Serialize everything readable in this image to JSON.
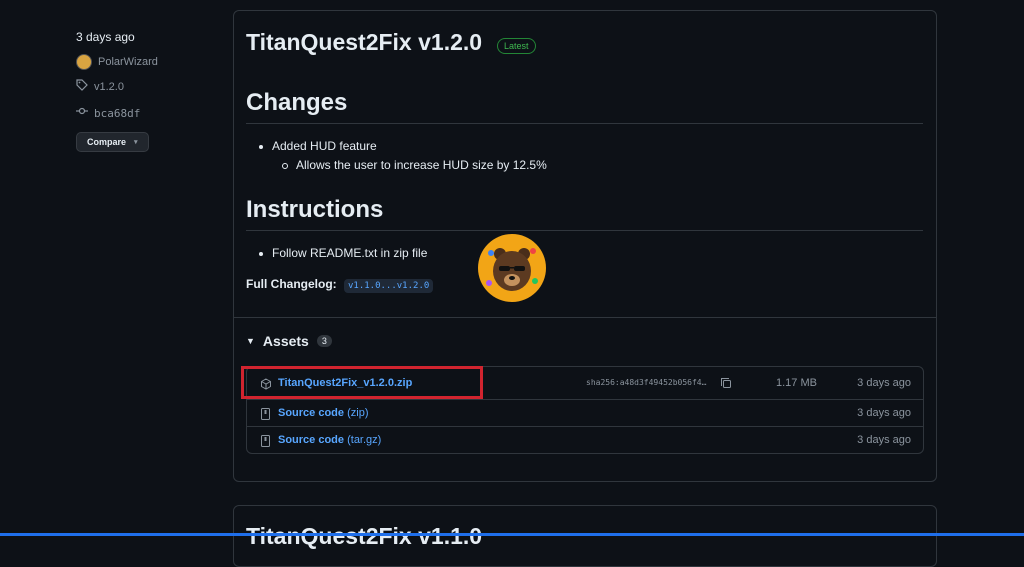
{
  "sidebar": {
    "date": "3 days ago",
    "author": "PolarWizard",
    "tag": "v1.2.0",
    "commit": "bca68df",
    "compare_label": "Compare"
  },
  "release": {
    "title": "TitanQuest2Fix v1.2.0",
    "badge": "Latest",
    "changes_heading": "Changes",
    "changes_item": "Added HUD feature",
    "changes_subitem": "Allows the user to increase HUD size by 12.5%",
    "instructions_heading": "Instructions",
    "instructions_item": "Follow README.txt in zip file",
    "changelog_label": "Full Changelog:",
    "changelog_link": "v1.1.0...v1.2.0"
  },
  "assets": {
    "heading": "Assets",
    "count": "3",
    "rows": [
      {
        "name": "TitanQuest2Fix_v1.2.0.zip",
        "sha": "sha256:a48d3f49452b056f4…",
        "size": "1.17 MB",
        "date": "3 days ago"
      },
      {
        "name": "Source code",
        "suffix": "(zip)",
        "date": "3 days ago"
      },
      {
        "name": "Source code",
        "suffix": "(tar.gz)",
        "date": "3 days ago"
      }
    ]
  },
  "next_release_title": "TitanQuest2Fix v1.1.0",
  "colors": {
    "background": "#0d1117",
    "link": "#58a6ff",
    "badge": "#3fb950",
    "highlight": "#d1242f"
  }
}
